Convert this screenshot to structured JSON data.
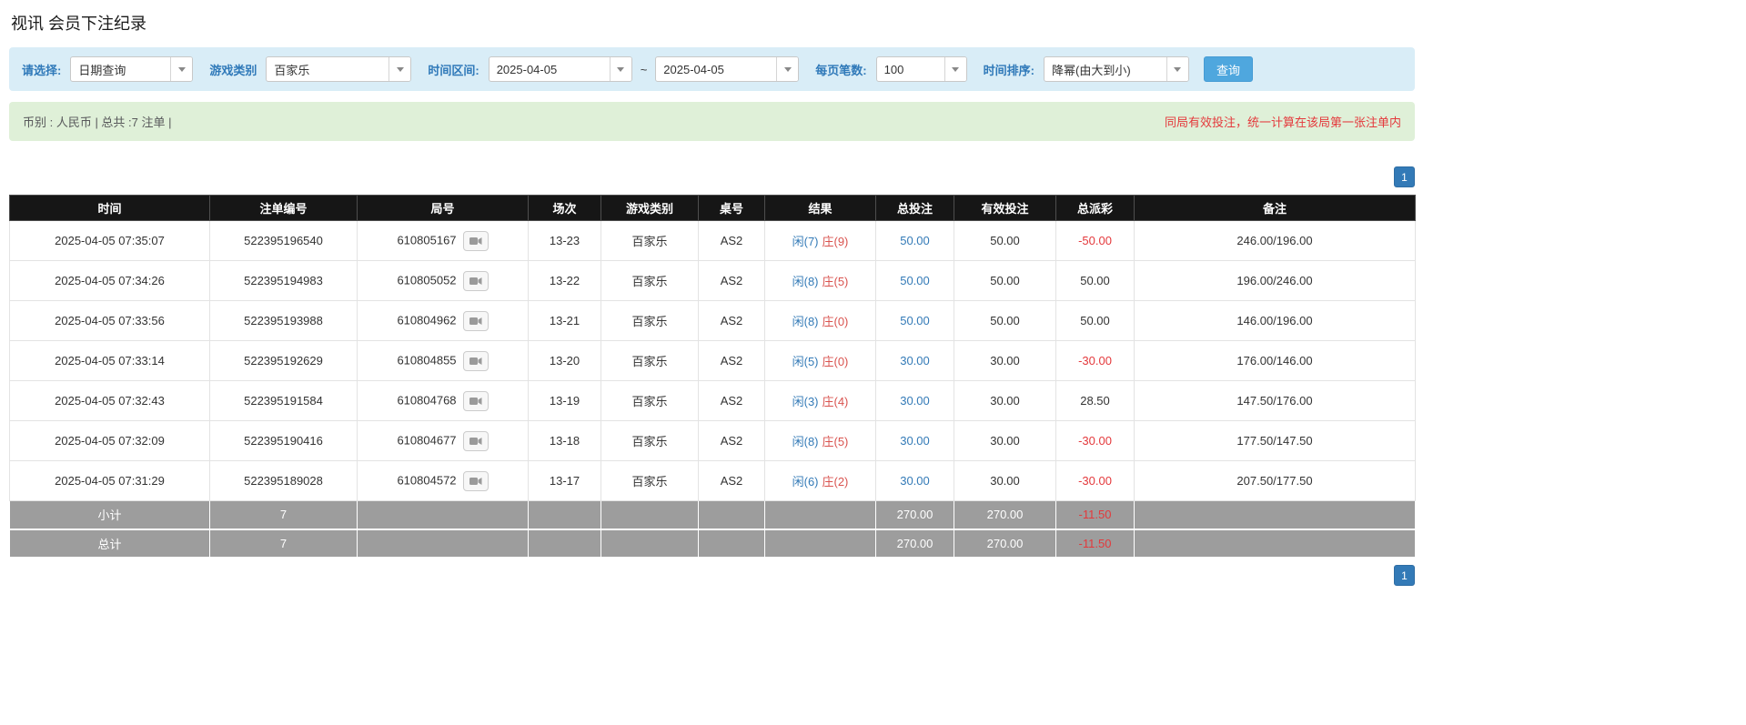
{
  "page": {
    "title": "视讯 会员下注纪录"
  },
  "filters": {
    "select": {
      "label": "请选择:",
      "value": "日期查询"
    },
    "game_type": {
      "label": "游戏类别",
      "value": "百家乐"
    },
    "time_range": {
      "label": "时间区间:",
      "from": "2025-04-05",
      "separator": "~",
      "to": "2025-04-05"
    },
    "page_size": {
      "label": "每页笔数:",
      "value": "100"
    },
    "sort": {
      "label": "时间排序:",
      "value": "降幂(由大到小)"
    },
    "query_button_label": "查询"
  },
  "summary": {
    "left": "币别 : 人民币 | 总共 :7 注单 |",
    "right": "同局有效投注，统一计算在该局第一张注单内"
  },
  "pagination": {
    "page": "1"
  },
  "colors": {
    "header_bg": "#161616",
    "footer_bg": "#9d9d9d",
    "accent_blue": "#337ab7",
    "player_blue": "#337ab7",
    "banker_red": "#d9534f",
    "negative_red": "#e4393c",
    "filter_bar_bg": "#d9edf7",
    "summary_bar_bg": "#dff0d8",
    "query_button_bg": "#4fa7de"
  },
  "table": {
    "headers": [
      "时间",
      "注单编号",
      "局号",
      "场次",
      "游戏类别",
      "桌号",
      "结果",
      "总投注",
      "有效投注",
      "总派彩",
      "备注"
    ],
    "rows": [
      {
        "time": "2025-04-05 07:35:07",
        "bet_id": "522395196540",
        "round_id": "610805167",
        "session": "13-23",
        "game": "百家乐",
        "table_no": "AS2",
        "result_player": "闲(7)",
        "result_banker": "庄(9)",
        "total_bet": "50.00",
        "valid_bet": "50.00",
        "payout": "-50.00",
        "remark": "246.00/196.00"
      },
      {
        "time": "2025-04-05 07:34:26",
        "bet_id": "522395194983",
        "round_id": "610805052",
        "session": "13-22",
        "game": "百家乐",
        "table_no": "AS2",
        "result_player": "闲(8)",
        "result_banker": "庄(5)",
        "total_bet": "50.00",
        "valid_bet": "50.00",
        "payout": "50.00",
        "remark": "196.00/246.00"
      },
      {
        "time": "2025-04-05 07:33:56",
        "bet_id": "522395193988",
        "round_id": "610804962",
        "session": "13-21",
        "game": "百家乐",
        "table_no": "AS2",
        "result_player": "闲(8)",
        "result_banker": "庄(0)",
        "total_bet": "50.00",
        "valid_bet": "50.00",
        "payout": "50.00",
        "remark": "146.00/196.00"
      },
      {
        "time": "2025-04-05 07:33:14",
        "bet_id": "522395192629",
        "round_id": "610804855",
        "session": "13-20",
        "game": "百家乐",
        "table_no": "AS2",
        "result_player": "闲(5)",
        "result_banker": "庄(0)",
        "total_bet": "30.00",
        "valid_bet": "30.00",
        "payout": "-30.00",
        "remark": "176.00/146.00"
      },
      {
        "time": "2025-04-05 07:32:43",
        "bet_id": "522395191584",
        "round_id": "610804768",
        "session": "13-19",
        "game": "百家乐",
        "table_no": "AS2",
        "result_player": "闲(3)",
        "result_banker": "庄(4)",
        "total_bet": "30.00",
        "valid_bet": "30.00",
        "payout": "28.50",
        "remark": "147.50/176.00"
      },
      {
        "time": "2025-04-05 07:32:09",
        "bet_id": "522395190416",
        "round_id": "610804677",
        "session": "13-18",
        "game": "百家乐",
        "table_no": "AS2",
        "result_player": "闲(8)",
        "result_banker": "庄(5)",
        "total_bet": "30.00",
        "valid_bet": "30.00",
        "payout": "-30.00",
        "remark": "177.50/147.50"
      },
      {
        "time": "2025-04-05 07:31:29",
        "bet_id": "522395189028",
        "round_id": "610804572",
        "session": "13-17",
        "game": "百家乐",
        "table_no": "AS2",
        "result_player": "闲(6)",
        "result_banker": "庄(2)",
        "total_bet": "30.00",
        "valid_bet": "30.00",
        "payout": "-30.00",
        "remark": "207.50/177.50"
      }
    ],
    "footer": [
      {
        "label": "小计",
        "count": "7",
        "total_bet": "270.00",
        "valid_bet": "270.00",
        "payout": "-11.50"
      },
      {
        "label": "总计",
        "count": "7",
        "total_bet": "270.00",
        "valid_bet": "270.00",
        "payout": "-11.50"
      }
    ]
  }
}
